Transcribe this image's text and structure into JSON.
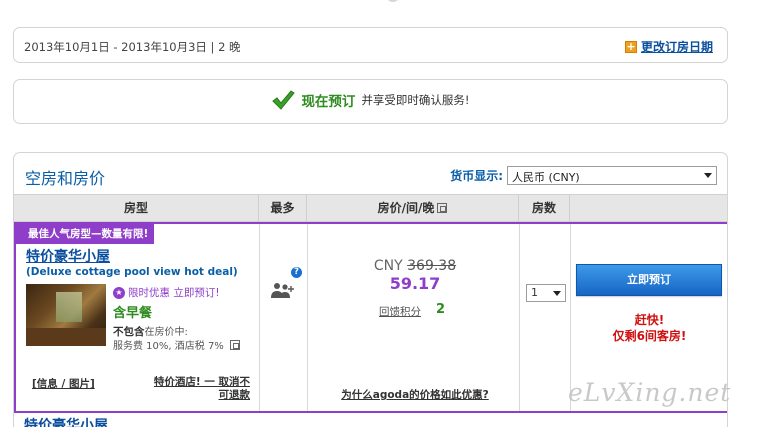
{
  "date_bar": {
    "dates": "2013年10月1日  - 2013年10月3日  | 2 晚",
    "change_label": "更改订房日期"
  },
  "confirm_bar": {
    "now": "现在预订",
    "enjoy": "并享受即时确认服务!"
  },
  "rooms": {
    "title": "空房和房价",
    "currency_label": "货币显示:",
    "currency_value": "人民币 (CNY)",
    "headers": [
      "房型",
      "最多",
      "房价/间/晚",
      "房数"
    ],
    "row": {
      "badge": "最佳人气房型—数量有限!",
      "name": "特价豪华小屋",
      "name_en": "(Deluxe cottage pool view hot deal)",
      "limited": "限时优惠  立即预订!",
      "breakfast": "含早餐",
      "exclusive_bold": "不包含",
      "exclusive_rest": "在房价中:",
      "fees": "服务费  10%, 酒店税  7%",
      "info_link": "[信息 / 图片]",
      "special_1": "特价酒店!  一  取消不",
      "special_2": "可退款",
      "currency": "CNY",
      "old_price": "369.38",
      "new_price": "59.17",
      "points_label": "回馈积分",
      "points_value": "2",
      "why_link": "为什么agoda的价格如此优惠?",
      "qty": "1",
      "book_label": "立即预订",
      "hurry_1": "赶快!",
      "hurry_2": "仅剩6间客房!"
    },
    "next_row_name": "特价豪华小屋"
  },
  "watermark": "eLvXing.net",
  "colors": {
    "accent_blue": "#0a5ea8",
    "purple": "#8e3ec9",
    "green": "#2e8b1f",
    "red": "#d01010"
  }
}
